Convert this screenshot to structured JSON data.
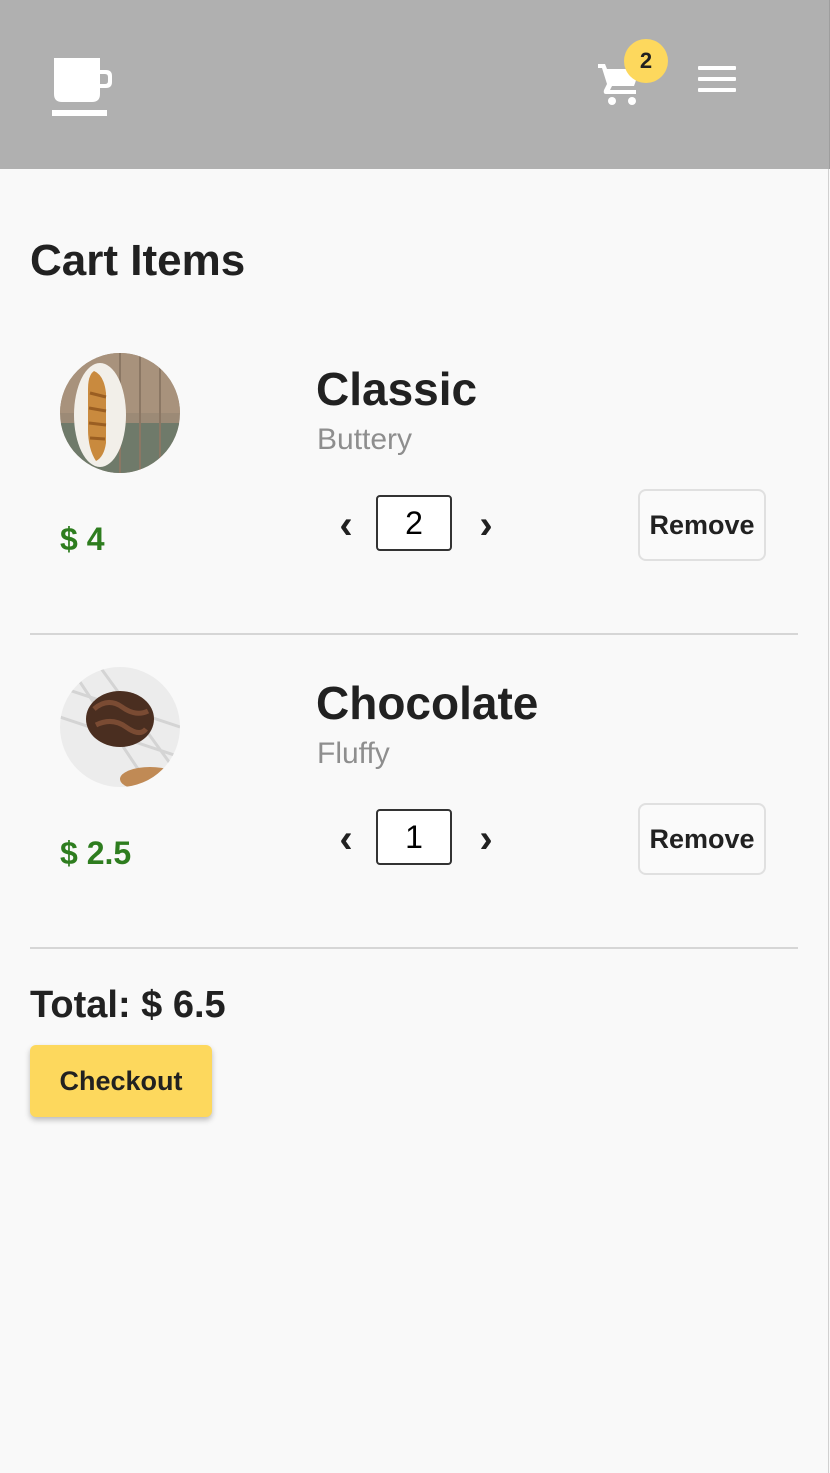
{
  "header": {
    "logo_icon": "coffee-cup-icon",
    "cart_icon": "shopping-cart-icon",
    "cart_count": "2",
    "menu_icon": "hamburger-menu-icon",
    "background_color": "#b0b0b0",
    "badge_color": "#fdd85d"
  },
  "page": {
    "title": "Cart Items"
  },
  "cart": {
    "items": [
      {
        "name": "Classic",
        "description": "Buttery",
        "price": "$ 4",
        "quantity": "2",
        "remove_label": "Remove",
        "decrement_glyph": "‹",
        "increment_glyph": "›",
        "image_icon": "croissant-photo"
      },
      {
        "name": "Chocolate",
        "description": "Fluffy",
        "price": "$ 2.5",
        "quantity": "1",
        "remove_label": "Remove",
        "decrement_glyph": "‹",
        "increment_glyph": "›",
        "image_icon": "chocolate-muffin-photo"
      }
    ],
    "total_label": "Total: $ 6.5",
    "checkout_label": "Checkout"
  },
  "colors": {
    "price_color": "#2e7d1f",
    "checkout_color": "#fdd85d",
    "description_color": "#8e8e8e"
  }
}
